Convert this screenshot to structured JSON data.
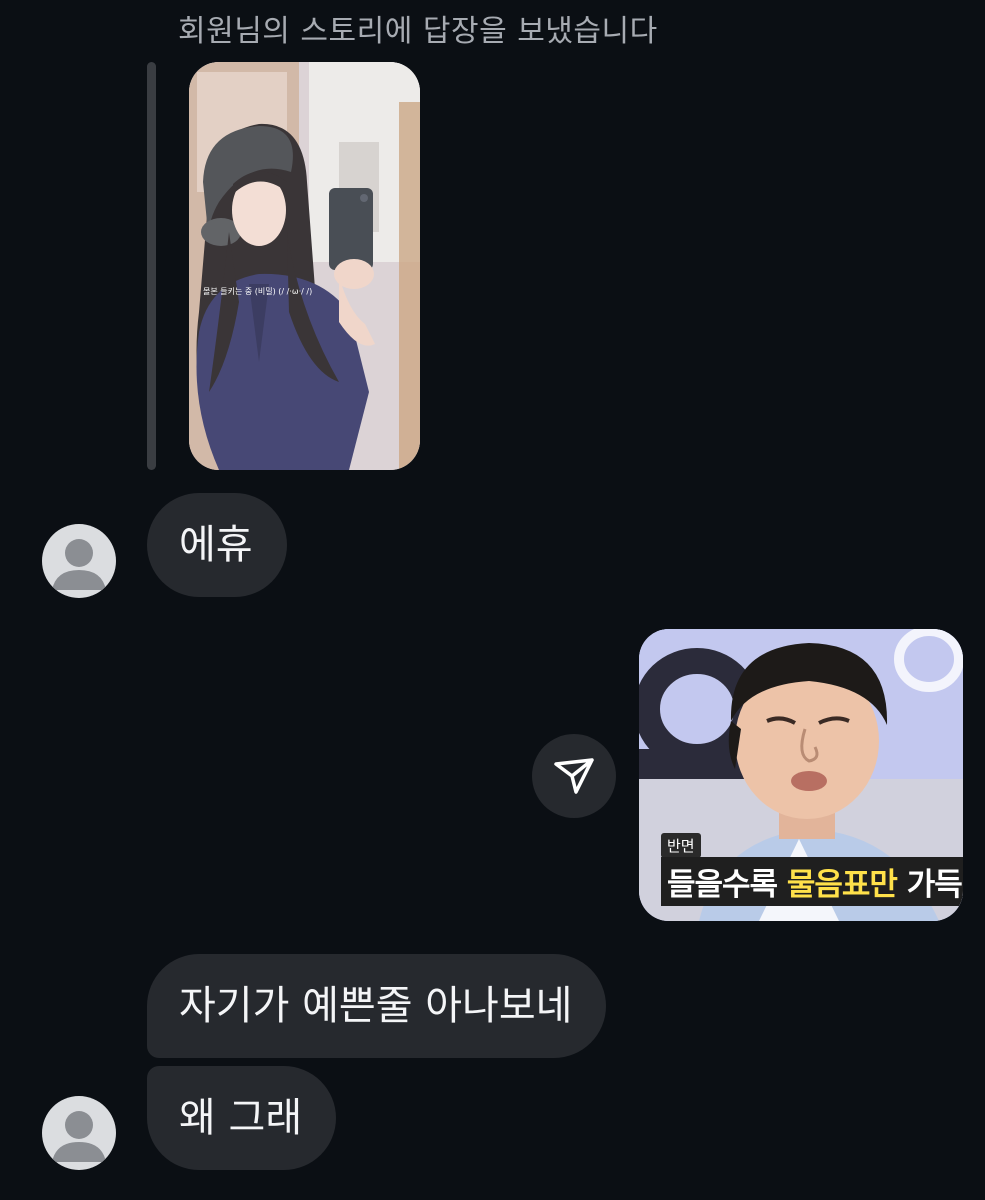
{
  "story_reply": {
    "caption": "회원님의 스토리에 답장을 보냈습니다",
    "story_overlay_text": "몰본 들키는 중 (비밀)   (/ /·ω·/ /)"
  },
  "messages": [
    {
      "sender": "other",
      "text": "에휴"
    },
    {
      "sender": "me",
      "type": "image",
      "image_tag": "반면",
      "image_caption_white": "들을수록 ",
      "image_caption_yellow": "물음표만 ",
      "image_caption_white2": "가득"
    },
    {
      "sender": "other",
      "text": "자기가 예쁜줄 아나보네"
    },
    {
      "sender": "other",
      "text": "왜 그래"
    }
  ],
  "icons": {
    "avatar": "default-avatar-icon",
    "share": "send-paper-plane-icon"
  },
  "colors": {
    "background": "#0b0f14",
    "bubble": "#26292e",
    "caption_text": "#a7abb2",
    "meme_highlight": "#ffe14a"
  }
}
